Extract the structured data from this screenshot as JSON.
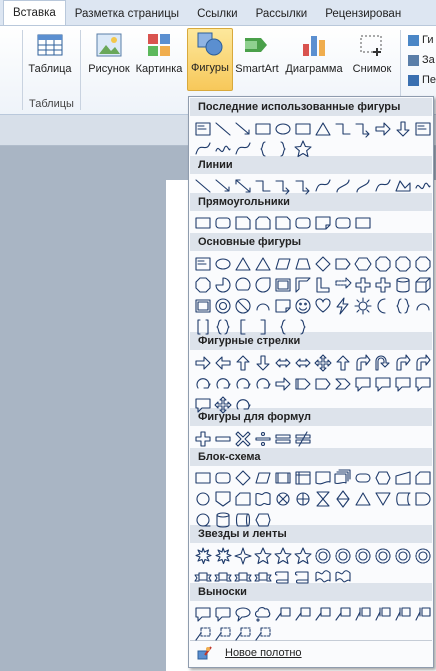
{
  "ribbon": {
    "tabs": [
      "Вставка",
      "Разметка страницы",
      "Ссылки",
      "Рассылки",
      "Рецензирован"
    ],
    "buttons": {
      "table": "Таблица",
      "picture": "Рисунок",
      "clipart": "Картинка",
      "shapes": "Фигуры",
      "smartart": "SmartArt",
      "chart": "Диаграмма",
      "screenshot": "Снимок"
    },
    "group_tables": "Таблицы",
    "right_items": [
      "Ги",
      "За",
      "Пе"
    ]
  },
  "menu": {
    "sections": [
      "Последние использованные фигуры",
      "Линии",
      "Прямоугольники",
      "Основные фигуры",
      "Фигурные стрелки",
      "Фигуры для формул",
      "Блок-схема",
      "Звезды и ленты",
      "Выноски"
    ],
    "new_canvas": "Новое полотно"
  },
  "colors": {
    "accent": "#f7c85a",
    "header_bg": "#dde3eb",
    "icon_stroke": "#1f3b6b"
  }
}
